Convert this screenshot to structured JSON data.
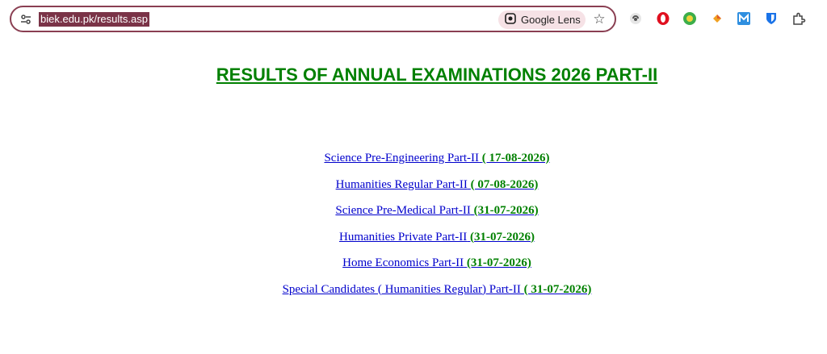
{
  "browser": {
    "url": "biek.edu.pk/results.asp",
    "lens_label": "Google Lens",
    "extensions": [
      "shield-icon",
      "opera-icon",
      "green-circle-icon",
      "diamond-icon",
      "m-square-icon",
      "bitwarden-icon",
      "puzzle-icon"
    ]
  },
  "page": {
    "title": "RESULTS OF ANNUAL EXAMINATIONS 2026 PART-II",
    "title_color": "#008000",
    "link_color": "#0000cc",
    "results": [
      {
        "name": "Science Pre-Engineering Part-II",
        "date": "( 17-08-2026)"
      },
      {
        "name": "Humanities Regular Part-II",
        "date": "( 07-08-2026)"
      },
      {
        "name": "Science Pre-Medical Part-II",
        "date": "(31-07-2026)"
      },
      {
        "name": "Humanities Private Part-II",
        "date": "(31-07-2026)"
      },
      {
        "name": "Home Economics Part-II",
        "date": "(31-07-2026)"
      },
      {
        "name": "Special Candidates ( Humanities Regular) Part-II",
        "date": "( 31-07-2026)"
      }
    ]
  }
}
